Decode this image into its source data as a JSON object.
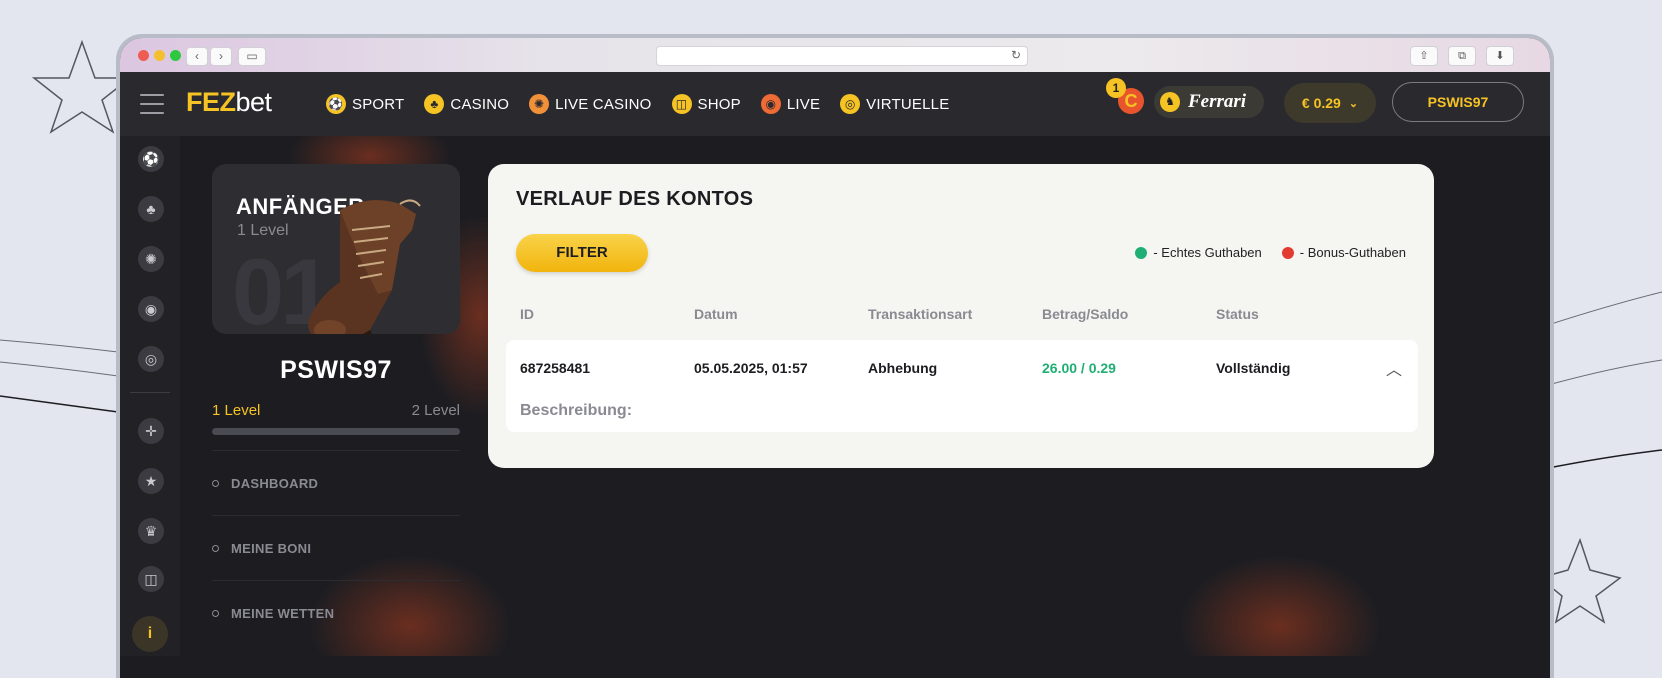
{
  "browser": {
    "back_icon": "chevron-left-icon",
    "forward_icon": "chevron-right-icon",
    "reload_icon": "reload-icon",
    "traffic_colors": [
      "#ee5c54",
      "#f4bf2f",
      "#2dc840"
    ]
  },
  "nav": {
    "logo_part1": "FEZ",
    "logo_part2": "bet",
    "menu": [
      {
        "label": "SPORT",
        "icon": "soccer-ball-icon"
      },
      {
        "label": "CASINO",
        "icon": "club-icon"
      },
      {
        "label": "LIVE CASINO",
        "icon": "roulette-icon"
      },
      {
        "label": "SHOP",
        "icon": "shopping-bag-icon"
      },
      {
        "label": "LIVE",
        "icon": "broadcast-icon"
      },
      {
        "label": "VIRTUELLE",
        "icon": "virtual-globe-icon"
      }
    ],
    "coin_badge": "1",
    "coin_letter": "C",
    "ferrari_label": "Ferrari",
    "balance": "€ 0.29",
    "username_button": "PSWIS97"
  },
  "profile": {
    "rank": "ANFÄNGER",
    "rank_level": "1 Level",
    "rank_number": "01",
    "username": "PSWIS97",
    "current_level": "1 Level",
    "next_level": "2 Level",
    "progress": 0.0,
    "links": [
      "DASHBOARD",
      "MEINE BONI",
      "MEINE WETTEN"
    ]
  },
  "account": {
    "title": "VERLAUF DES KONTOS",
    "filter_label": "FILTER",
    "legend": [
      {
        "label": "- Echtes Guthaben",
        "color": "#1faf74"
      },
      {
        "label": "- Bonus-Guthaben",
        "color": "#e23c32"
      }
    ],
    "columns": [
      "ID",
      "Datum",
      "Transaktionsart",
      "Betrag/Saldo",
      "Status"
    ],
    "rows": [
      {
        "id": "687258481",
        "date": "05.05.2025, 01:57",
        "type": "Abhebung",
        "amount": "26.00 / 0.29",
        "status": "Vollständig",
        "description_label": "Beschreibung:"
      }
    ]
  },
  "rail_icons": [
    "soccer-ball-icon",
    "club-icon",
    "roulette-icon",
    "broadcast-icon",
    "virtual-globe-icon",
    "target-icon",
    "star-icon",
    "trophy-icon",
    "shopping-bag-icon"
  ],
  "info_label": "i"
}
